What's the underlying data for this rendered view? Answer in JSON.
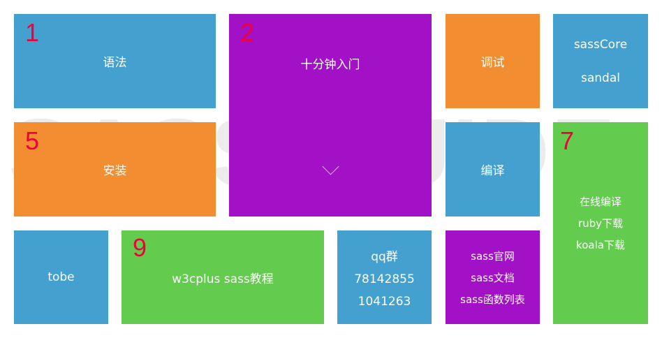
{
  "watermark": "SASS GUIDE",
  "tiles": {
    "t1": {
      "num": "1",
      "label": "语法"
    },
    "t2": {
      "num": "2",
      "label": "十分钟入门"
    },
    "debug": {
      "label": "调试"
    },
    "core": {
      "lines": [
        "sassCore",
        "sandal"
      ]
    },
    "t5": {
      "num": "5",
      "label": "安装"
    },
    "compile": {
      "label": "编译"
    },
    "t7": {
      "num": "7",
      "lines": [
        "在线编译",
        "ruby下载",
        "koala下载"
      ]
    },
    "tobe": {
      "label": "tobe"
    },
    "t9": {
      "num": "9",
      "label": "w3cplus sass教程"
    },
    "qq": {
      "lines": [
        "qq群",
        "78142855",
        "1041263"
      ]
    },
    "docs": {
      "lines": [
        "sass官网",
        "sass文档",
        "sass函数列表"
      ]
    }
  },
  "colors": {
    "blue": "#44a0cf",
    "purple": "#a311c6",
    "orange": "#f28e31",
    "green": "#63cc4e",
    "number": "#f0003c"
  }
}
